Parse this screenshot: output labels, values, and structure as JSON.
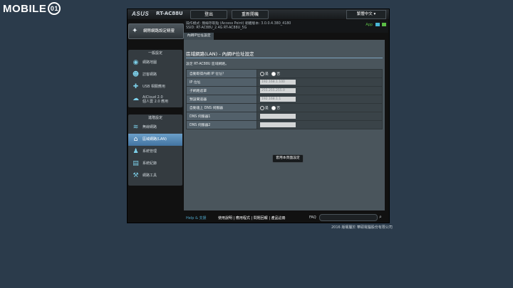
{
  "watermark": {
    "text": "MOBILE",
    "suffix": "01"
  },
  "header": {
    "brand": "ASUS",
    "model": "RT-AC88U",
    "logout": "登出",
    "reboot": "重新開機",
    "language": "繁體中文"
  },
  "info": {
    "line1": "操作模式: 無線存取點 (Access Point)   韌體版本: 3.0.0.4.380_4180",
    "line2": "SSID:  RT-AC88U_2.4G   RT-AC88U_5G",
    "app": "App"
  },
  "sidebar": {
    "qis": "網際網路設定精靈",
    "general_header": "一般設定",
    "general": [
      "網路地圖",
      "訪客網路",
      "USB 相關應用",
      "AiCloud 2.0\n個人雲 2.0 應用"
    ],
    "advanced_header": "進階設定",
    "advanced": [
      "無線網路",
      "區域網路(LAN)",
      "系統管理",
      "系統紀錄",
      "網路工具"
    ]
  },
  "tab": {
    "label": "內網IP位址設定"
  },
  "content": {
    "title": "區域網路(LAN) - 內網IP位址設定",
    "description": "設定 RT-AC88U 區域網路。",
    "rows": [
      {
        "label": "自動取得內網 IP 位址？",
        "value": "",
        "type": "radio",
        "options": [
          "是",
          "否"
        ],
        "selected": 1
      },
      {
        "label": "IP 位址",
        "value": "192.168.1.100",
        "type": "input"
      },
      {
        "label": "子網路遮罩",
        "value": "255.255.255.0",
        "type": "input"
      },
      {
        "label": "預設閘道器",
        "value": "192.168.1.1",
        "type": "input"
      },
      {
        "label": "自動連上 DNS 伺服器",
        "value": "",
        "type": "radio",
        "options": [
          "是",
          "否"
        ],
        "selected": 1
      },
      {
        "label": "DNS 伺服器1",
        "value": "",
        "type": "input"
      },
      {
        "label": "DNS 伺服器2",
        "value": "",
        "type": "input"
      }
    ],
    "apply": "套用本頁面設定"
  },
  "footer": {
    "help": "Help & 支援",
    "links": "使用說明 | 應用程式 | 問題回報 | 產品註冊",
    "faq": "FAQ"
  },
  "copyright": "2016 版權屬於 華碩電腦股份有限公司",
  "colors": {
    "page_bg": "#2b3b4b",
    "active_menu": "#4f83b0",
    "panel": "#4a555c"
  }
}
